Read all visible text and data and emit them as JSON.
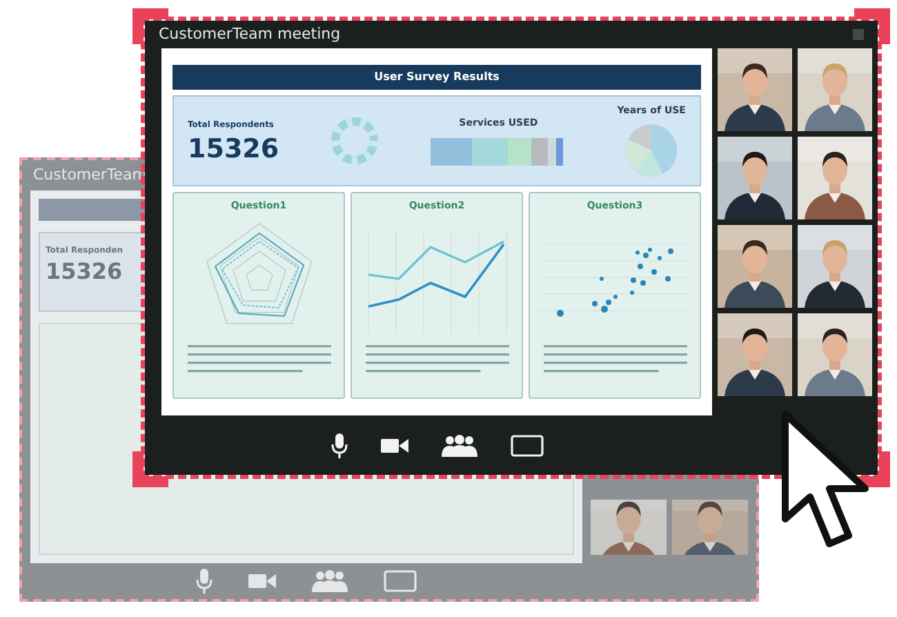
{
  "back_window": {
    "title": "CustomerTeam",
    "total_label": "Total Responden",
    "total_value": "15326",
    "toolbar": [
      {
        "kind": "mic"
      },
      {
        "kind": "camera"
      },
      {
        "kind": "people"
      },
      {
        "kind": "screen"
      }
    ]
  },
  "front_window": {
    "title": "CustomerTeam meeting",
    "dashboard": {
      "header": "User Survey Results",
      "total_label": "Total Respondents",
      "total_value": "15326",
      "services_title": "Services USED",
      "years_title": "Years of USE",
      "questions": [
        {
          "title": "Question1",
          "kind": "radar"
        },
        {
          "title": "Question2",
          "kind": "line"
        },
        {
          "title": "Question3",
          "kind": "scatter"
        }
      ]
    },
    "toolbar": [
      {
        "kind": "mic"
      },
      {
        "kind": "camera"
      },
      {
        "kind": "people"
      },
      {
        "kind": "screen"
      }
    ]
  }
}
